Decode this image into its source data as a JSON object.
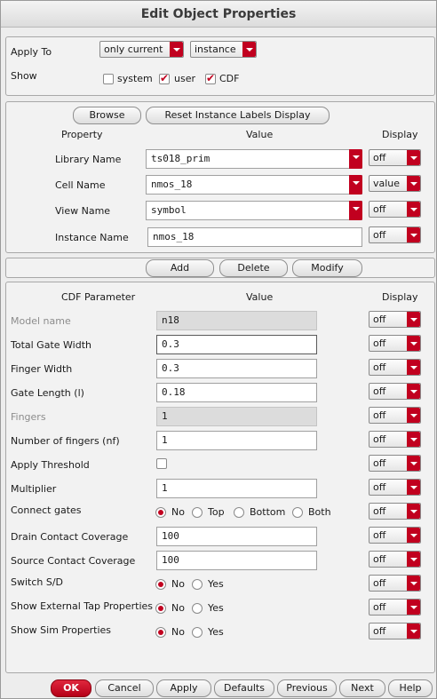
{
  "title": "Edit Object Properties",
  "apply_to": {
    "label": "Apply To",
    "scope": "only current",
    "type": "instance"
  },
  "show": {
    "label": "Show",
    "system": "system",
    "user": "user",
    "cdf": "CDF"
  },
  "top_buttons": {
    "browse": "Browse",
    "reset": "Reset Instance Labels Display"
  },
  "prop_headers": {
    "property": "Property",
    "value": "Value",
    "display": "Display"
  },
  "props": [
    {
      "name": "Library Name",
      "value": "ts018_prim",
      "display": "off"
    },
    {
      "name": "Cell Name",
      "value": "nmos_18",
      "display": "value"
    },
    {
      "name": "View Name",
      "value": "symbol",
      "display": "off"
    },
    {
      "name": "Instance Name",
      "value": "nmos_18",
      "display": "off"
    }
  ],
  "mid_buttons": {
    "add": "Add",
    "delete": "Delete",
    "modify": "Modify"
  },
  "cdf_headers": {
    "param": "CDF Parameter",
    "value": "Value",
    "display": "Display"
  },
  "cdf": {
    "model_name": {
      "label": "Model name",
      "value": "n18",
      "display": "off"
    },
    "total_gate_width": {
      "label": "Total Gate Width",
      "value": "0.3",
      "display": "off"
    },
    "finger_width": {
      "label": "Finger Width",
      "value": "0.3",
      "display": "off"
    },
    "gate_length": {
      "label": "Gate Length (l)",
      "value": "0.18",
      "display": "off"
    },
    "fingers": {
      "label": "Fingers",
      "value": "1",
      "display": "off"
    },
    "nf": {
      "label": "Number of fingers (nf)",
      "value": "1",
      "display": "off"
    },
    "apply_threshold": {
      "label": "Apply Threshold",
      "display": "off"
    },
    "multiplier": {
      "label": "Multiplier",
      "value": "1",
      "display": "off"
    },
    "connect_gates": {
      "label": "Connect gates",
      "opts": [
        "No",
        "Top",
        "Bottom",
        "Both"
      ],
      "display": "off"
    },
    "drain_cov": {
      "label": "Drain Contact Coverage",
      "value": "100",
      "display": "off"
    },
    "source_cov": {
      "label": "Source Contact Coverage",
      "value": "100",
      "display": "off"
    },
    "switch_sd": {
      "label": "Switch S/D",
      "no": "No",
      "yes": "Yes",
      "display": "off"
    },
    "ext_tap": {
      "label": "Show External Tap Properties",
      "no": "No",
      "yes": "Yes",
      "display": "off"
    },
    "sim_props": {
      "label": "Show Sim Properties",
      "no": "No",
      "yes": "Yes",
      "display": "off"
    }
  },
  "footer": {
    "ok": "OK",
    "cancel": "Cancel",
    "apply": "Apply",
    "defaults": "Defaults",
    "previous": "Previous",
    "next": "Next",
    "help": "Help"
  }
}
